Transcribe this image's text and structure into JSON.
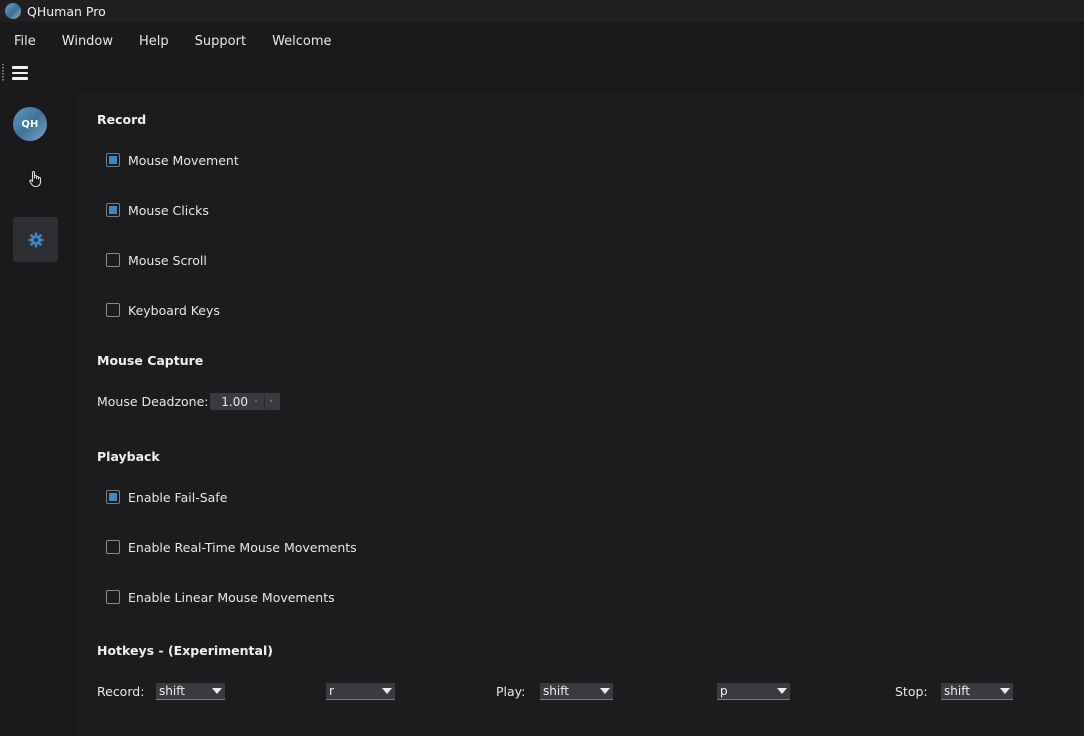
{
  "titlebar": {
    "title": "QHuman Pro"
  },
  "menu": [
    "File",
    "Window",
    "Help",
    "Support",
    "Welcome"
  ],
  "sidebar": {
    "avatar_text": "QH"
  },
  "record": {
    "title": "Record",
    "options": [
      {
        "label": "Mouse Movement",
        "checked": true
      },
      {
        "label": "Mouse Clicks",
        "checked": true
      },
      {
        "label": "Mouse Scroll",
        "checked": false
      },
      {
        "label": "Keyboard Keys",
        "checked": false
      }
    ]
  },
  "mouse_capture": {
    "title": "Mouse Capture",
    "deadzone_label": "Mouse Deadzone:",
    "deadzone_value": "1.00"
  },
  "playback": {
    "title": "Playback",
    "options": [
      {
        "label": "Enable Fail-Safe",
        "checked": true
      },
      {
        "label": "Enable Real-Time Mouse Movements",
        "checked": false
      },
      {
        "label": "Enable Linear Mouse Movements",
        "checked": false
      }
    ]
  },
  "hotkeys": {
    "title": "Hotkeys - (Experimental)",
    "record_label": "Record:",
    "record_modifier": "shift",
    "record_key": "r",
    "play_label": "Play:",
    "play_modifier": "shift",
    "play_key": "p",
    "stop_label": "Stop:",
    "stop_modifier": "shift"
  },
  "colors": {
    "accent": "#3f87c3",
    "background": "#1c1c1e",
    "sidebar": "#1a1a1c"
  }
}
